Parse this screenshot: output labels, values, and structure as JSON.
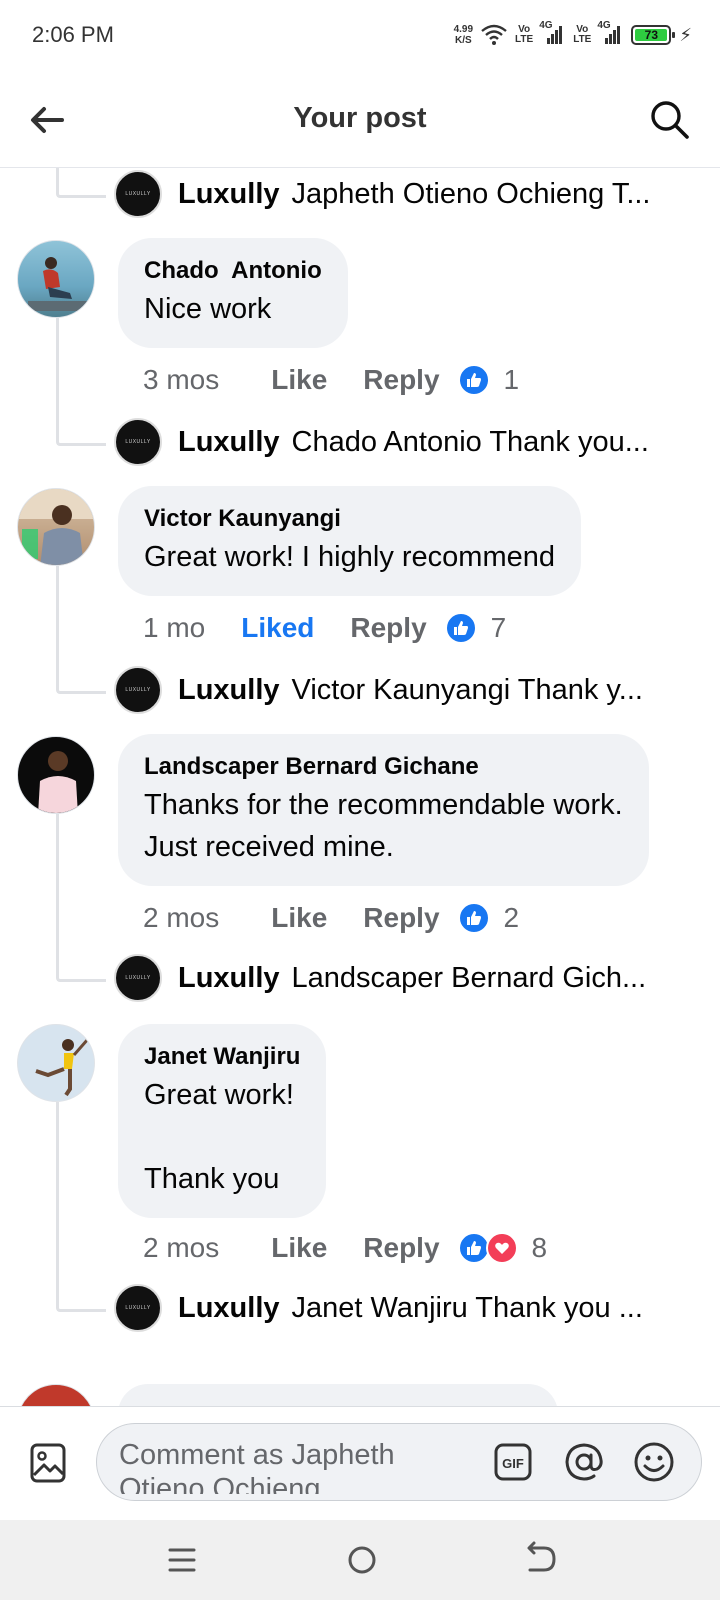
{
  "status_bar": {
    "time": "2:06 PM",
    "net_speed_value": "4.99",
    "net_speed_unit": "K/S",
    "volte1_top": "Vo",
    "volte1_bottom": "LTE",
    "signal1_label": "4G",
    "volte2_top": "Vo",
    "volte2_bottom": "LTE",
    "signal2_label": "4G",
    "battery": "73"
  },
  "header": {
    "title": "Your post",
    "back_icon": "arrow-left-icon",
    "search_icon": "search-icon"
  },
  "replies": [
    {
      "author": "Luxully",
      "text": "Japheth Otieno Ochieng T..."
    },
    {
      "author": "Luxully",
      "text": "Chado  Antonio Thank you..."
    },
    {
      "author": "Luxully",
      "text": "Victor Kaunyangi Thank y..."
    },
    {
      "author": "Luxully",
      "text": "Landscaper Bernard Gich..."
    },
    {
      "author": "Luxully",
      "text": "Janet Wanjiru Thank you ..."
    }
  ],
  "comments": [
    {
      "author": "Chado  Antonio",
      "text": "Nice work",
      "time": "3 mos",
      "like": "Like",
      "reply": "Reply",
      "reaction_count": "1"
    },
    {
      "author": "Victor Kaunyangi",
      "text": "Great work! I highly recommend",
      "time": "1 mo",
      "like": "Liked",
      "reply": "Reply",
      "reaction_count": "7"
    },
    {
      "author": "Landscaper Bernard Gichane",
      "text": "Thanks for the recommendable work.\nJust received mine.",
      "time": "2 mos",
      "like": "Like",
      "reply": "Reply",
      "reaction_count": "2"
    },
    {
      "author": "Janet Wanjiru",
      "text": "Great work!\n\nThank you",
      "time": "2 mos",
      "like": "Like",
      "reply": "Reply",
      "reaction_count": "8"
    }
  ],
  "composer": {
    "placeholder": "Comment as Japheth Otieno Ochieng",
    "gif_label": "GIF"
  },
  "colors": {
    "accent": "#1877f2",
    "love": "#f33e58",
    "bubble": "#f0f2f5",
    "secondary_text": "#65676b"
  }
}
